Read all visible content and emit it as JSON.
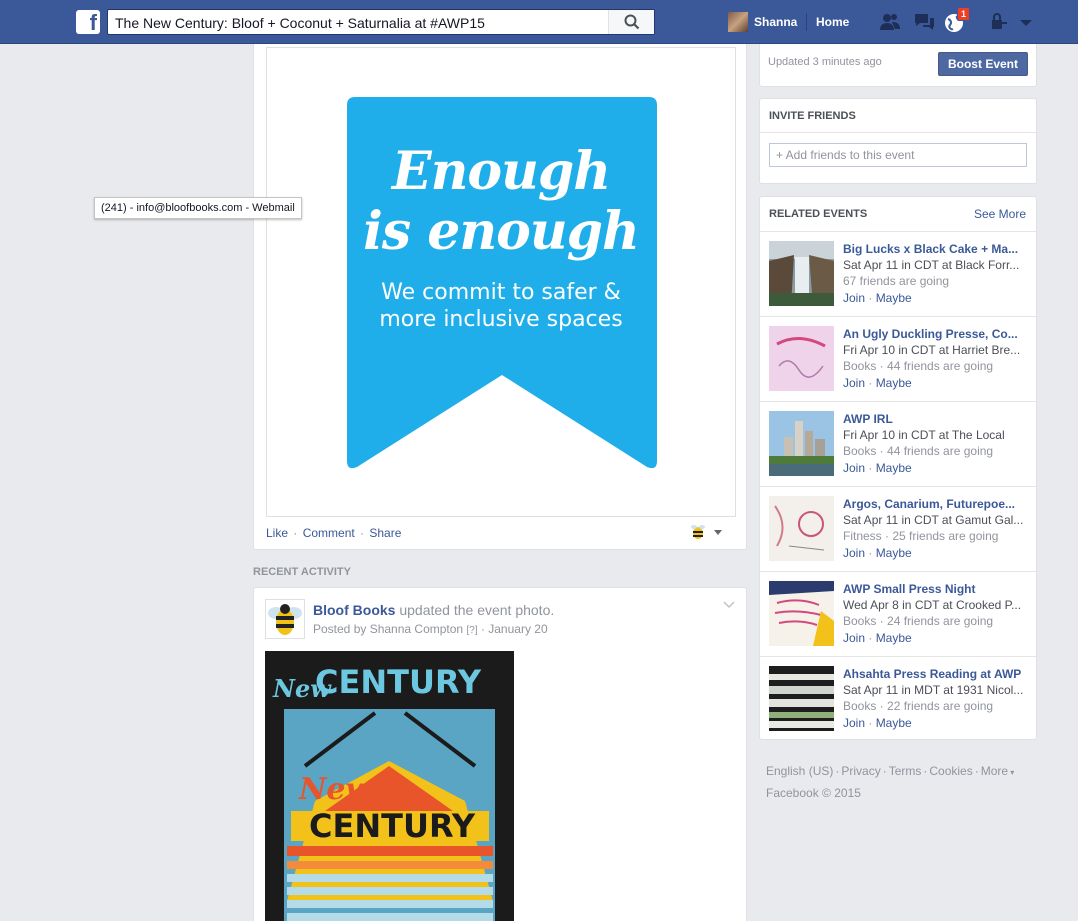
{
  "header": {
    "search_value": "The New Century: Bloof + Coconut + Saturnalia at #AWP15",
    "user_name": "Shanna",
    "home_label": "Home",
    "notifications_count": "1"
  },
  "photo_post": {
    "ribbon_line1": "Enough",
    "ribbon_line2": "is enough",
    "ribbon_line3": "We commit to safer &",
    "ribbon_line4": "more inclusive spaces",
    "like_label": "Like",
    "comment_label": "Comment",
    "share_label": "Share",
    "ribbon_color": "#20aeea"
  },
  "recent_activity": {
    "title": "RECENT ACTIVITY",
    "actor": "Bloof Books",
    "action": " updated the event photo.",
    "posted_by": "Posted by Shanna Compton",
    "help_mark": "[?]",
    "date": "January 20",
    "poster_line1": "New",
    "poster_line2": "CENTURY",
    "poster_line3": "New",
    "poster_line4": "CENTURY"
  },
  "sidebar": {
    "updated_text": "Updated 3 minutes ago",
    "boost_label": "Boost Event",
    "invite_title": "INVITE FRIENDS",
    "invite_placeholder": "+ Add friends to this event",
    "related_title": "RELATED EVENTS",
    "see_more_label": "See More",
    "events": [
      {
        "title": "Big Lucks x Black Cake + Ma...",
        "when": "Sat Apr 11 in CDT at Black Forr...",
        "meta": "67 friends are going",
        "join": "Join",
        "maybe": "Maybe"
      },
      {
        "title": "An Ugly Duckling Presse, Co...",
        "when": "Fri Apr 10 in CDT at Harriet Bre...",
        "meta": "Books · 44 friends are going",
        "join": "Join",
        "maybe": "Maybe"
      },
      {
        "title": "AWP IRL",
        "when": "Fri Apr 10 in CDT at The Local",
        "meta": "Books · 44 friends are going",
        "join": "Join",
        "maybe": "Maybe"
      },
      {
        "title": "Argos, Canarium, Futurepoe...",
        "when": "Sat Apr 11 in CDT at Gamut Gal...",
        "meta": "Fitness · 25 friends are going",
        "join": "Join",
        "maybe": "Maybe"
      },
      {
        "title": "AWP Small Press Night",
        "when": "Wed Apr 8 in CDT at Crooked P...",
        "meta": "Books · 24 friends are going",
        "join": "Join",
        "maybe": "Maybe"
      },
      {
        "title": "Ahsahta Press Reading at AWP",
        "when": "Sat Apr 11 in MDT at 1931 Nicol...",
        "meta": "Books · 22 friends are going",
        "join": "Join",
        "maybe": "Maybe"
      }
    ]
  },
  "footer": {
    "links": [
      "English (US)",
      "Privacy",
      "Terms",
      "Cookies",
      "More"
    ],
    "copyright": "Facebook © 2015"
  },
  "tooltip": "(241) - info@bloofbooks.com - Webmail"
}
